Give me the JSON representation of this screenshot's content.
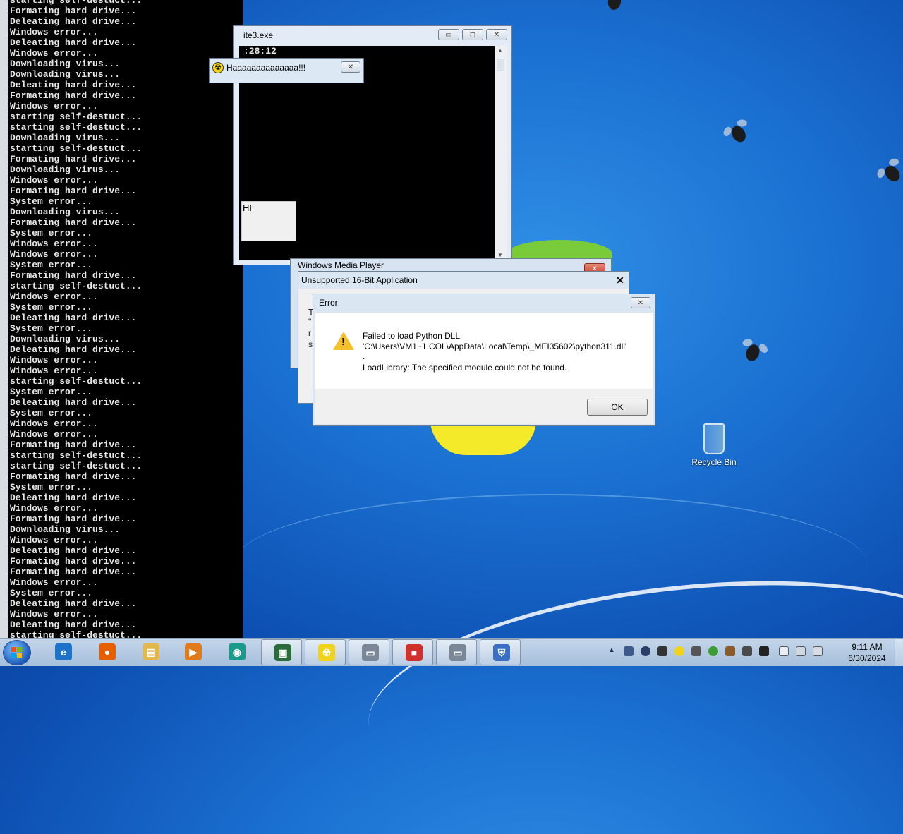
{
  "console": {
    "lines": [
      "starting self-destuct...",
      "Formating hard drive...",
      "Deleating hard drive...",
      "Windows error...",
      "Deleating hard drive...",
      "Windows error...",
      "Downloading virus...",
      "Downloading virus...",
      "Deleating hard drive...",
      "Formating hard drive...",
      "Windows error...",
      "starting self-destuct...",
      "starting self-destuct...",
      "Downloading virus...",
      "starting self-destuct...",
      "Formating hard drive...",
      "Downloading virus...",
      "Windows error...",
      "Formating hard drive...",
      "System error...",
      "Downloading virus...",
      "Formating hard drive...",
      "System error...",
      "Windows error...",
      "Windows error...",
      "System error...",
      "Formating hard drive...",
      "starting self-destuct...",
      "Windows error...",
      "System error...",
      "Deleating hard drive...",
      "System error...",
      "Downloading virus...",
      "Deleating hard drive...",
      "Windows error...",
      "Windows error...",
      "starting self-destuct...",
      "System error...",
      "Deleating hard drive...",
      "System error...",
      "Windows error...",
      "Windows error...",
      "Formating hard drive...",
      "starting self-destuct...",
      "starting self-destuct...",
      "Formating hard drive...",
      "System error...",
      "Deleating hard drive...",
      "Windows error...",
      "Formating hard drive...",
      "Downloading virus...",
      "Windows error...",
      "Deleating hard drive...",
      "Formating hard drive...",
      "Formating hard drive...",
      "Windows error...",
      "System error...",
      "Deleating hard drive...",
      "Windows error...",
      "Deleating hard drive...",
      "starting self-destuct..."
    ]
  },
  "console2": {
    "title": "ite3.exe",
    "output": ":28:12",
    "minimize": "▭",
    "maximize": "◻",
    "close": "✕"
  },
  "haa_window": {
    "title": "Haaaaaaaaaaaaaa!!!",
    "close": "✕"
  },
  "hi_box": {
    "text": "HI"
  },
  "wmp_window": {
    "title": "Windows Media Player"
  },
  "unsupported_window": {
    "title": "Unsupported 16-Bit Application",
    "close": "✕",
    "fragments": [
      "T",
      "\"",
      "r",
      "s"
    ]
  },
  "error_dialog": {
    "title": "Error",
    "close": "✕",
    "warning_glyph": "!",
    "line1": "Failed to load Python DLL",
    "line2": "'C:\\Users\\VM1~1.COL\\AppData\\Local\\Temp\\_MEI35602\\python311.dll'",
    "line3": ".",
    "line4": "LoadLibrary: The specified module could not be found.",
    "ok_label": "OK"
  },
  "desktop": {
    "recycle_bin_label": "Recycle Bin"
  },
  "taskbar": {
    "items": [
      {
        "name": "internet-explorer",
        "glyph": "e",
        "color": "#1e73c8"
      },
      {
        "name": "firefox",
        "glyph": "●",
        "color": "#e66000"
      },
      {
        "name": "file-explorer",
        "glyph": "▤",
        "color": "#e0b84c"
      },
      {
        "name": "media-player",
        "glyph": "▶",
        "color": "#e07a1a"
      },
      {
        "name": "globe-app",
        "glyph": "◉",
        "color": "#1a9a8a"
      },
      {
        "name": "console-app",
        "glyph": "▣",
        "color": "#2b6d3a"
      },
      {
        "name": "radiation-app",
        "glyph": "☢",
        "color": "#f1d41a"
      },
      {
        "name": "exe-app-1",
        "glyph": "▭",
        "color": "#7b8796"
      },
      {
        "name": "shapes-app",
        "glyph": "■",
        "color": "#d0312d"
      },
      {
        "name": "exe-app-2",
        "glyph": "▭",
        "color": "#7b8796"
      },
      {
        "name": "shield-app",
        "glyph": "⛨",
        "color": "#3a6fc4"
      }
    ],
    "clock_time": "9:11 AM",
    "clock_date": "6/30/2024",
    "tray_arrow": "▲"
  }
}
